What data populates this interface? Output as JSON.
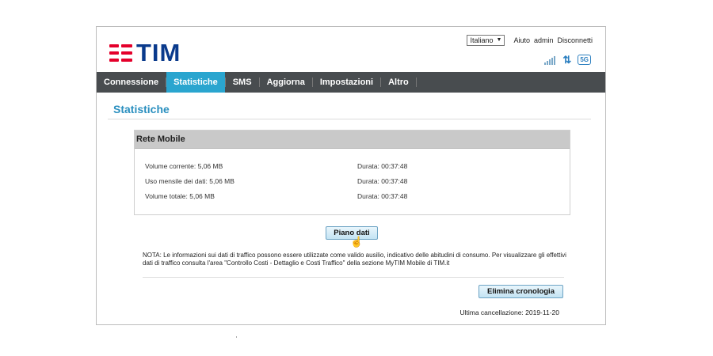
{
  "brand": {
    "logo_text": "TIM",
    "brand_color": "#0a3a8c",
    "mark_color": "#e4002b"
  },
  "topbar": {
    "language": "Italiano",
    "links": [
      "Aiuto",
      "admin",
      "Disconnetti"
    ],
    "status_icons": [
      "signal-icon",
      "data-transfer-icon",
      "network-5g-icon"
    ],
    "network_badge": "5G"
  },
  "nav": {
    "items": [
      "Connessione",
      "Statistiche",
      "SMS",
      "Aggiorna",
      "Impostazioni",
      "Altro"
    ],
    "active": "Statistiche",
    "active_color": "#2aa5cf"
  },
  "page": {
    "title": "Statistiche"
  },
  "panel": {
    "title": "Rete Mobile",
    "rows": [
      {
        "label": "Volume corrente: 5,06 MB",
        "duration": "Durata: 00:37:48"
      },
      {
        "label": "Uso mensile dei dati: 5,06 MB",
        "duration": "Durata: 00:37:48"
      },
      {
        "label": "Volume totale: 5,06 MB",
        "duration": "Durata: 00:37:48"
      }
    ]
  },
  "buttons": {
    "data_plan": "Piano dati",
    "clear_history": "Elimina cronologia"
  },
  "note": "NOTA: Le informazioni sui dati di traffico possono essere utilizzate come valido ausilio, indicativo delle abitudini di consumo. Per visualizzare gli effettivi dati di traffico consulta l'area \"Controllo Costi - Dettaglio e Costi Traffico\" della sezione MyTIM Mobile di TIM.it",
  "last_cleared": "Ultima cancellazione: 2019-11-20"
}
